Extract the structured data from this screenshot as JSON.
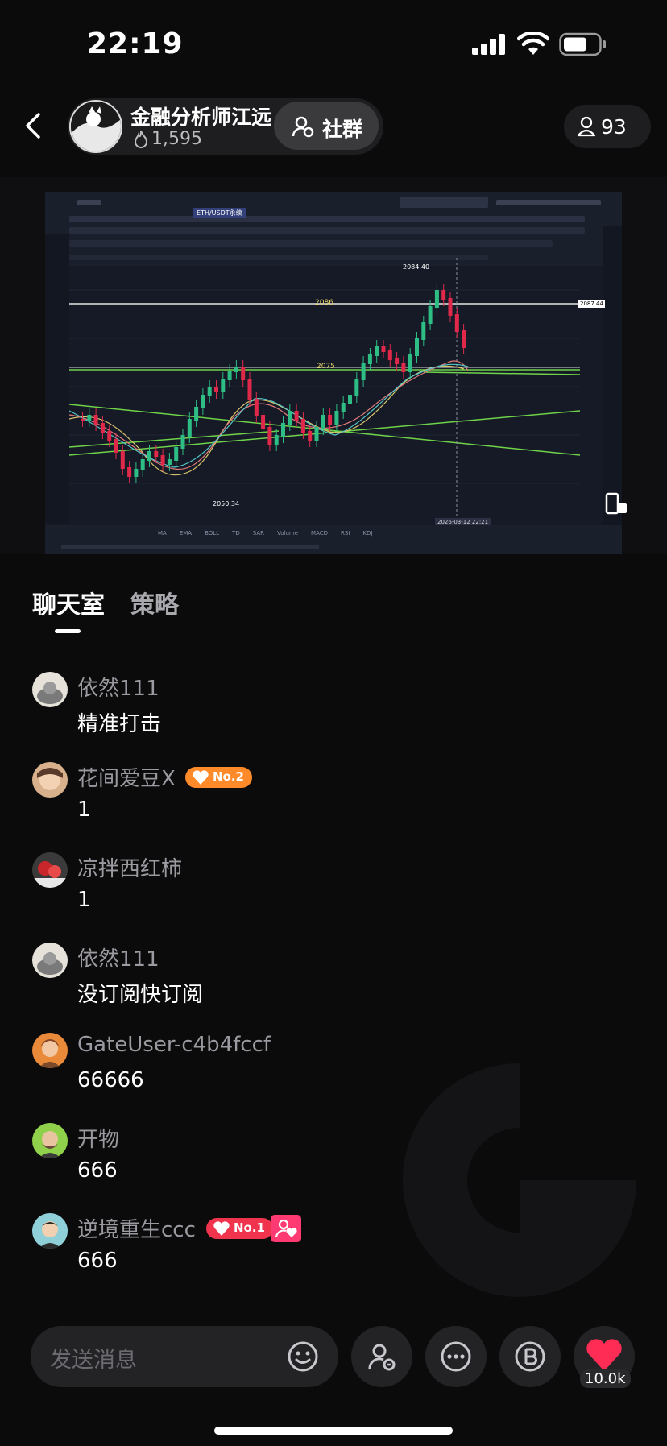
{
  "status_bar": {
    "time": "22:19"
  },
  "header": {
    "host_name": "金融分析师江远",
    "host_likes": "1,595",
    "group_button_label": "社群",
    "viewers_count": "93"
  },
  "chart_overlay": {
    "high_label": "2084.40",
    "low_label": "2050.34",
    "line_2086": "2086",
    "line_2075": "2075",
    "price_tag": "2087.44",
    "tab_label": "ETH/USDT永续",
    "date_label": "2026-03-12 22:21",
    "indicators": [
      "MA",
      "EMA",
      "BOLL",
      "TD",
      "SAR",
      "Volume",
      "MACD",
      "RSI",
      "KDJ"
    ]
  },
  "tabs": {
    "chat": "聊天室",
    "strategy": "策略"
  },
  "messages": [
    {
      "user": "依然111",
      "text": "精准打击"
    },
    {
      "user": "花间爱豆X",
      "text": "1",
      "badge": "No.2"
    },
    {
      "user": "凉拌西红柿",
      "text": "1"
    },
    {
      "user": "依然111",
      "text": "没订阅快订阅"
    },
    {
      "user": "GateUser-c4b4fccf",
      "text": "66666"
    },
    {
      "user": "开物",
      "text": "666"
    },
    {
      "user": "逆境重生ccc",
      "text": "666",
      "badge": "No.1"
    }
  ],
  "input": {
    "placeholder": "发送消息"
  },
  "like_count": "10.0k",
  "colors": {
    "accent_red": "#ff3a5c",
    "badge_orange": "#ff8a2a",
    "badge_red": "#f0344e"
  }
}
